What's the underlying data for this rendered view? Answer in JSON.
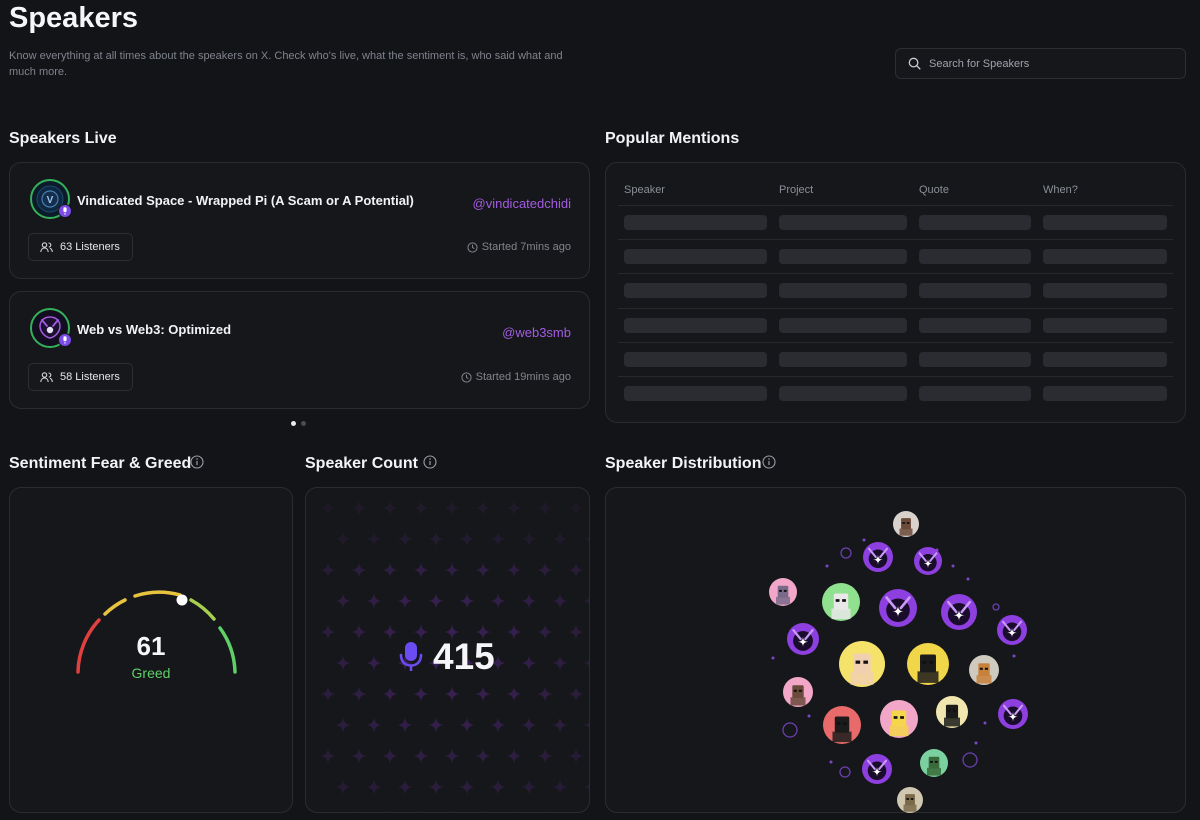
{
  "header": {
    "title": "Speakers",
    "description": "Know everything at all times about the speakers on X. Check who's live, what the sentiment is, who said what and much more."
  },
  "search": {
    "placeholder": "Search for Speakers",
    "icon": "search-icon"
  },
  "speakers_live": {
    "title": "Speakers Live",
    "cards": [
      {
        "title": "Vindicated Space - Wrapped Pi (A Scam or A Potential)",
        "handle": "@vindicatedchidi",
        "listeners": "63 Listeners",
        "started": "Started 7mins ago"
      },
      {
        "title": "Web vs Web3: Optimized",
        "handle": "@web3smb",
        "listeners": "58 Listeners",
        "started": "Started 19mins ago"
      }
    ],
    "pagination": {
      "pages": 2,
      "active": 1
    }
  },
  "popular_mentions": {
    "title": "Popular Mentions",
    "columns": [
      "Speaker",
      "Project",
      "Quote",
      "When?"
    ],
    "loading_rows": 6
  },
  "sentiment": {
    "title": "Sentiment Fear & Greed",
    "value": "61",
    "label": "Greed",
    "colors": {
      "fear": "#e0413f",
      "neutral": "#e8c43e",
      "greed": "#5fcf68"
    }
  },
  "speaker_count": {
    "title": "Speaker Count",
    "value": "415",
    "icon": "microphone-icon",
    "accent": "#6a4cf2"
  },
  "speaker_distribution": {
    "title": "Speaker Distribution"
  },
  "colors": {
    "accent_purple": "#a25ce0",
    "live_ring": "#34b15a",
    "background": "#131417"
  }
}
